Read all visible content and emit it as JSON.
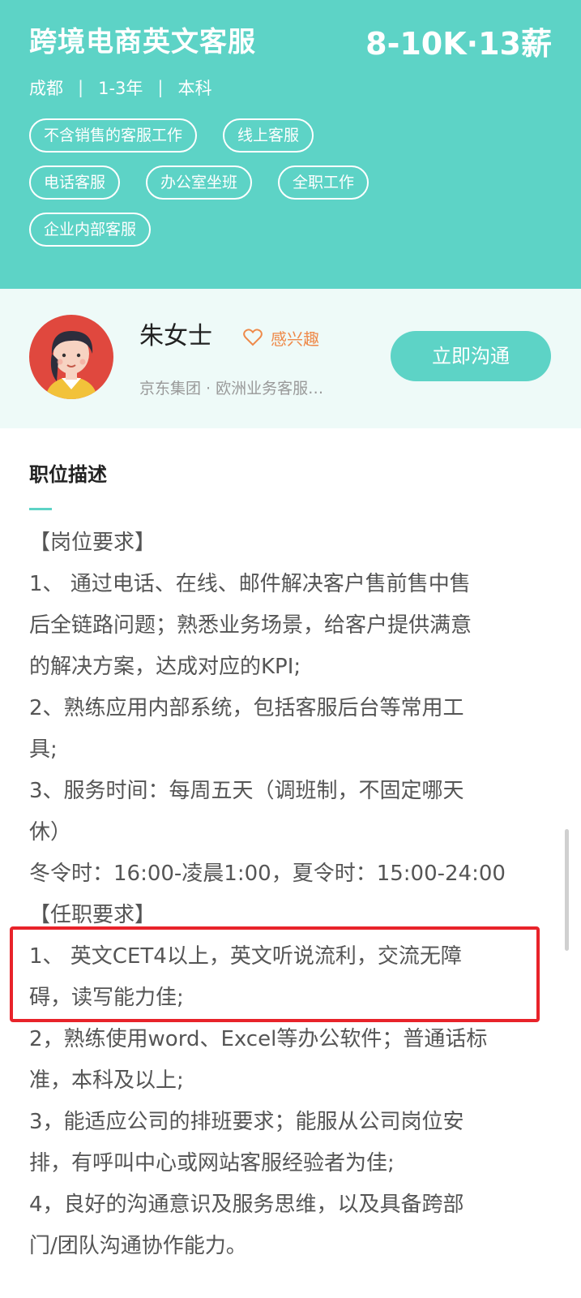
{
  "job": {
    "title": "跨境电商英文客服",
    "salary": "8-10K·13薪",
    "city": "成都",
    "experience": "1-3年",
    "education": "本科",
    "separator": "|",
    "tags": [
      "不含销售的客服工作",
      "线上客服",
      "电话客服",
      "办公室坐班",
      "全职工作",
      "企业内部客服"
    ]
  },
  "recruiter": {
    "name": "朱女士",
    "interest_label": "感兴趣",
    "company": "京东集团 · 欧洲业务客服…",
    "chat_button_label": "立即沟通"
  },
  "description": {
    "title": "职位描述",
    "lines": [
      "【岗位要求】",
      "1、 通过电话、在线、邮件解决客户售前售中售",
      "后全链路问题；熟悉业务场景，给客户提供满意",
      "的解决方案，达成对应的KPI;",
      "2、熟练应用内部系统，包括客服后台等常用工",
      "具;",
      "3、服务时间：每周五天（调班制，不固定哪天",
      "休）",
      "冬令时：16:00-凌晨1:00，夏令时：15:00-24:00",
      "【任职要求】",
      "1、 英文CET4以上，英文听说流利，交流无障",
      "碍，读写能力佳;",
      "2，熟练使用word、Excel等办公软件；普通话标",
      "准，本科及以上;",
      "3，能适应公司的排班要求；能服从公司岗位安",
      "排，有呼叫中心或网站客服经验者为佳;",
      "4，良好的沟通意识及服务思维，以及具备跨部",
      "门/团队沟通协作能力。"
    ]
  },
  "colors": {
    "primary": "#5dd3c6",
    "card_bg": "#eefaf8",
    "interest": "#ee8a4a",
    "highlight": "#e8232a"
  },
  "icons": {
    "heart": "heart-outline-icon",
    "avatar": "female-recruiter-avatar"
  }
}
